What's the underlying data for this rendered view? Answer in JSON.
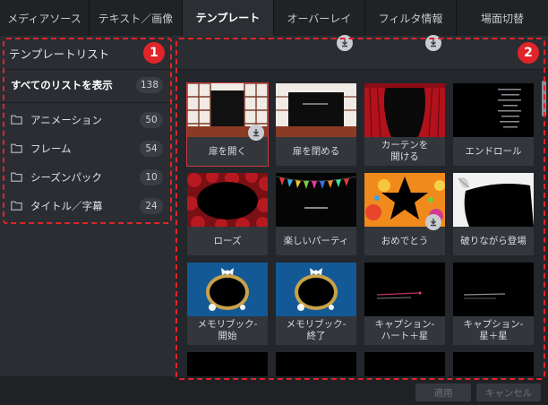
{
  "tabs": [
    {
      "label": "メディアソース",
      "active": false
    },
    {
      "label": "テキスト／画像",
      "active": false
    },
    {
      "label": "テンプレート",
      "active": true
    },
    {
      "label": "オーバーレイ",
      "active": false
    },
    {
      "label": "フィルタ情報",
      "active": false
    },
    {
      "label": "場面切替",
      "active": false
    }
  ],
  "left_panel": {
    "title": "テンプレートリスト",
    "all": {
      "label": "すべてのリストを表示",
      "count": "138"
    },
    "folders": [
      {
        "label": "アニメーション",
        "count": "50"
      },
      {
        "label": "フレーム",
        "count": "54"
      },
      {
        "label": "シーズンパック",
        "count": "10"
      },
      {
        "label": "タイトル／字幕",
        "count": "24"
      }
    ]
  },
  "annotations": {
    "one": "1",
    "two": "2"
  },
  "templates": [
    {
      "label": "扉を開く",
      "thumb": "door-open",
      "download": false,
      "selected": true
    },
    {
      "label": "扉を閉める",
      "thumb": "door-close",
      "download": true,
      "selected": false
    },
    {
      "label": "カーテンを\n開ける",
      "thumb": "curtain",
      "download": true,
      "selected": false
    },
    {
      "label": "エンドロール",
      "thumb": "credits",
      "download": false,
      "selected": false
    },
    {
      "label": "ローズ",
      "thumb": "rose",
      "download": true,
      "selected": false
    },
    {
      "label": "楽しいパーティ",
      "thumb": "party",
      "download": false,
      "selected": false
    },
    {
      "label": "おめでとう",
      "thumb": "congrats",
      "download": false,
      "selected": false
    },
    {
      "label": "破りながら登場",
      "thumb": "tear",
      "download": false,
      "selected": false
    },
    {
      "label": "メモリブック-\n開始",
      "thumb": "memory",
      "download": false,
      "selected": false
    },
    {
      "label": "メモリブック-\n終了",
      "thumb": "memory",
      "download": false,
      "selected": false
    },
    {
      "label": "キャプション-\nハート＋星",
      "thumb": "caption-heart",
      "download": true,
      "selected": false
    },
    {
      "label": "キャプション-\n星＋星",
      "thumb": "caption-star",
      "download": false,
      "selected": false
    }
  ],
  "buttons": {
    "apply": "適用",
    "cancel": "キャンセル"
  },
  "colors": {
    "accent_red": "#e0242a",
    "panel": "#2a2d31",
    "caption": "#33373c"
  },
  "icons": {
    "folder": "folder-icon",
    "download": "download-icon"
  }
}
